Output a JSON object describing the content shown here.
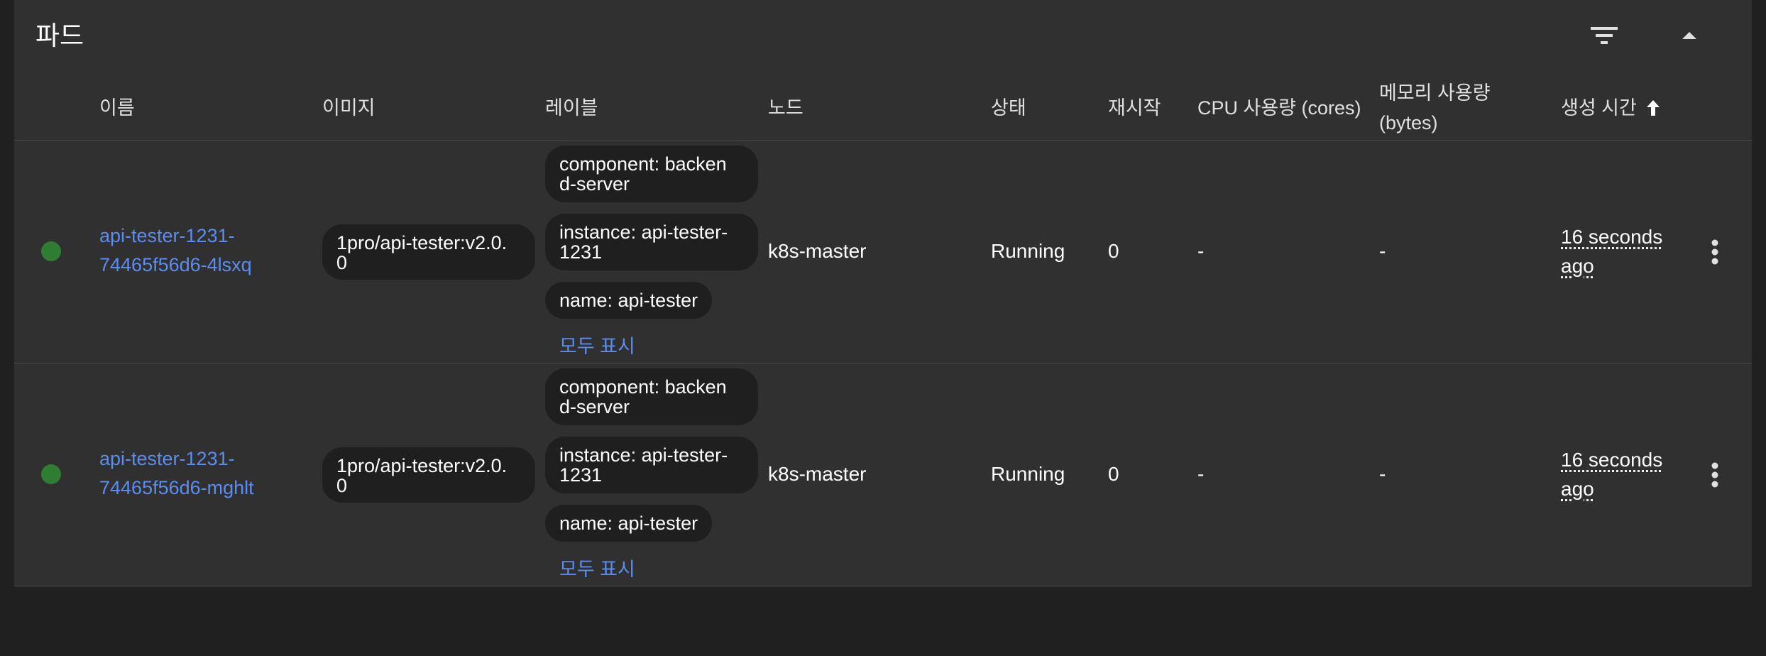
{
  "panel": {
    "title": "파드",
    "filter_icon": "filter-list-icon",
    "collapse_icon": "arrow-up-icon"
  },
  "columns": {
    "name": "이름",
    "image": "이미지",
    "labels": "레이블",
    "node": "노드",
    "status": "상태",
    "restarts": "재시작",
    "cpu": "CPU 사용량 (cores)",
    "memory_line1": "메모리 사용량",
    "memory_line2": "(bytes)",
    "created": "생성 시간",
    "sort_icon": "arrow-upward-icon"
  },
  "rows": [
    {
      "status_color": "#2e7d32",
      "name_line1": "api-tester-1231-",
      "name_line2": "74465f56d6-4lsxq",
      "image_line1": "1pro/api-tester:v2.0.",
      "image_line2": "0",
      "labels": [
        {
          "line1": "component: backen",
          "line2": "d-server"
        },
        {
          "line1": "instance: api-tester-",
          "line2": "1231"
        },
        {
          "line1": "name: api-tester",
          "line2": ""
        }
      ],
      "show_all": "모두 표시",
      "node": "k8s-master",
      "status": "Running",
      "restarts": "0",
      "cpu": "-",
      "memory": "-",
      "age_line1": "16 seconds",
      "age_line2": "ago",
      "menu_icon": "more-vert-icon"
    },
    {
      "status_color": "#2e7d32",
      "name_line1": "api-tester-1231-",
      "name_line2": "74465f56d6-mghlt",
      "image_line1": "1pro/api-tester:v2.0.",
      "image_line2": "0",
      "labels": [
        {
          "line1": "component: backen",
          "line2": "d-server"
        },
        {
          "line1": "instance: api-tester-",
          "line2": "1231"
        },
        {
          "line1": "name: api-tester",
          "line2": ""
        }
      ],
      "show_all": "모두 표시",
      "node": "k8s-master",
      "status": "Running",
      "restarts": "0",
      "cpu": "-",
      "memory": "-",
      "age_line1": "16 seconds",
      "age_line2": "ago",
      "menu_icon": "more-vert-icon"
    }
  ]
}
